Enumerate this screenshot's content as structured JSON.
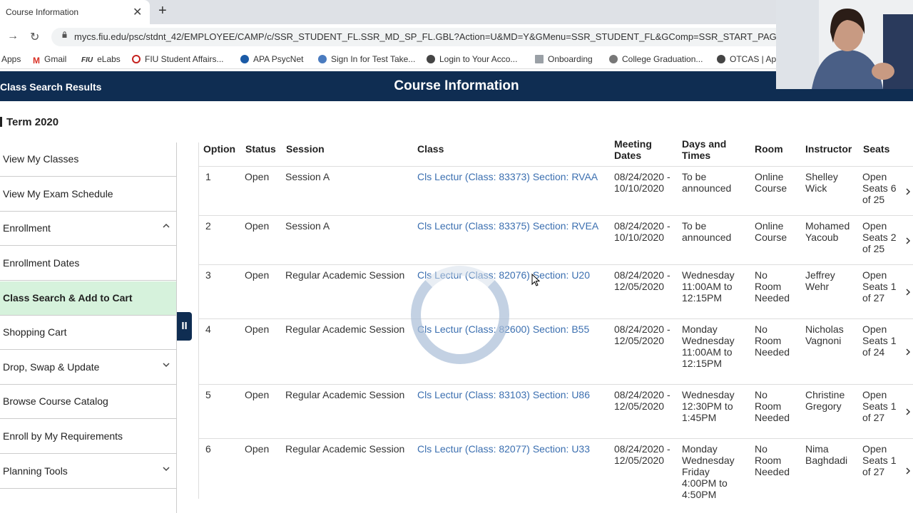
{
  "browser": {
    "tab_title": "Course Information",
    "tab_close": "✕",
    "new_tab": "+",
    "back": "→",
    "reload": "↻",
    "url": "mycs.fiu.edu/psc/stdnt_42/EMPLOYEE/CAMP/c/SSR_STUDENT_FL.SSR_MD_SP_FL.GBL?Action=U&MD=Y&GMenu=SSR_STUDENT_FL&GComp=SSR_START_PAGE_F",
    "bookmarks": [
      {
        "label": "Apps",
        "icon": "apps-icon"
      },
      {
        "label": "Gmail",
        "icon": "gmail-icon",
        "color": "#d93025"
      },
      {
        "label": "eLabs",
        "prefix": "FIU",
        "icon": "fiu-icon"
      },
      {
        "label": "FIU Student Affairs...",
        "icon": "fiu-student-affairs-icon",
        "color": "#c5221f"
      },
      {
        "label": "APA PsycNet",
        "icon": "apa-icon",
        "color": "#1a5aa6"
      },
      {
        "label": "Sign In for Test Take...",
        "icon": "test-icon",
        "color": "#4a7bbf"
      },
      {
        "label": "Login to Your Acco...",
        "icon": "globe-icon",
        "color": "#444"
      },
      {
        "label": "Onboarding",
        "icon": "doc-icon",
        "color": "#9aa0a6"
      },
      {
        "label": "College Graduation...",
        "icon": "grad-icon",
        "color": "#666"
      },
      {
        "label": "OTCAS | Ap",
        "icon": "globe-icon",
        "color": "#444"
      }
    ]
  },
  "header": {
    "left": "Class Search Results",
    "title": "Course Information"
  },
  "term": "Term 2020",
  "sidebar": {
    "items": [
      {
        "label": "View My Classes",
        "chevron": ""
      },
      {
        "label": "View My Exam Schedule",
        "chevron": ""
      },
      {
        "label": "Enrollment",
        "chevron": "up"
      },
      {
        "label": "Enrollment Dates",
        "chevron": ""
      },
      {
        "label": "Class Search & Add to Cart",
        "chevron": "",
        "active": true
      },
      {
        "label": "Shopping Cart",
        "chevron": ""
      },
      {
        "label": "Drop, Swap & Update",
        "chevron": "down"
      },
      {
        "label": "Browse Course Catalog",
        "chevron": ""
      },
      {
        "label": "Enroll by My Requirements",
        "chevron": ""
      },
      {
        "label": "Planning Tools",
        "chevron": "down"
      }
    ]
  },
  "pause_label": "II",
  "table": {
    "headers": [
      "Option",
      "Status",
      "Session",
      "Class",
      "Meeting Dates",
      "Days and Times",
      "Room",
      "Instructor",
      "Seats"
    ],
    "rows": [
      {
        "option": "1",
        "status": "Open",
        "session": "Session A",
        "class": "Cls Lectur (Class: 83373) Section: RVAA",
        "dates": [
          "08/24/2020 -",
          "10/10/2020"
        ],
        "times": [
          "To be",
          "announced"
        ],
        "room": [
          "Online",
          "Course"
        ],
        "instructor": [
          "Shelley",
          "Wick"
        ],
        "seats": [
          "Open",
          "Seats 6",
          "of 25"
        ]
      },
      {
        "option": "2",
        "status": "Open",
        "session": "Session A",
        "class": "Cls Lectur (Class: 83375) Section: RVEA",
        "dates": [
          "08/24/2020 -",
          "10/10/2020"
        ],
        "times": [
          "To be",
          "announced"
        ],
        "room": [
          "Online",
          "Course"
        ],
        "instructor": [
          "Mohamed",
          "Yacoub"
        ],
        "seats": [
          "Open",
          "Seats 2",
          "of 25"
        ]
      },
      {
        "option": "3",
        "status": "Open",
        "session": "Regular Academic Session",
        "class": "Cls Lectur (Class: 82076) Section: U20",
        "dates": [
          "08/24/2020 -",
          "12/05/2020"
        ],
        "times": [
          "Wednesday",
          "11:00AM to",
          "12:15PM"
        ],
        "room": [
          "No",
          "Room",
          "Needed"
        ],
        "instructor": [
          "Jeffrey",
          "Wehr"
        ],
        "seats": [
          "Open",
          "Seats 1",
          "of 27"
        ]
      },
      {
        "option": "4",
        "status": "Open",
        "session": "Regular Academic Session",
        "class": "Cls Lectur (Class: 82600) Section: B55",
        "dates": [
          "08/24/2020 -",
          "12/05/2020"
        ],
        "times": [
          "Monday",
          "Wednesday",
          "11:00AM to",
          "12:15PM"
        ],
        "room": [
          "No",
          "Room",
          "Needed"
        ],
        "instructor": [
          "Nicholas",
          "Vagnoni"
        ],
        "seats": [
          "Open",
          "Seats 1",
          "of 24"
        ]
      },
      {
        "option": "5",
        "status": "Open",
        "session": "Regular Academic Session",
        "class": "Cls Lectur (Class: 83103) Section: U86",
        "dates": [
          "08/24/2020 -",
          "12/05/2020"
        ],
        "times": [
          "Wednesday",
          "12:30PM to",
          "1:45PM"
        ],
        "room": [
          "No",
          "Room",
          "Needed"
        ],
        "instructor": [
          "Christine",
          "Gregory"
        ],
        "seats": [
          "Open",
          "Seats 1",
          "of 27"
        ]
      },
      {
        "option": "6",
        "status": "Open",
        "session": "Regular Academic Session",
        "class": "Cls Lectur (Class: 82077) Section: U33",
        "dates": [
          "08/24/2020 -",
          "12/05/2020"
        ],
        "times": [
          "Monday",
          "Wednesday",
          "Friday",
          "4:00PM to",
          "4:50PM"
        ],
        "room": [
          "No",
          "Room",
          "Needed"
        ],
        "instructor": [
          "Nima",
          "Baghdadi"
        ],
        "seats": [
          "Open",
          "Seats 1",
          "of 27"
        ]
      }
    ]
  },
  "colors": {
    "brand_navy": "#0f2d52",
    "active_green": "#d6f2dc",
    "link_blue": "#3b6fb0"
  }
}
